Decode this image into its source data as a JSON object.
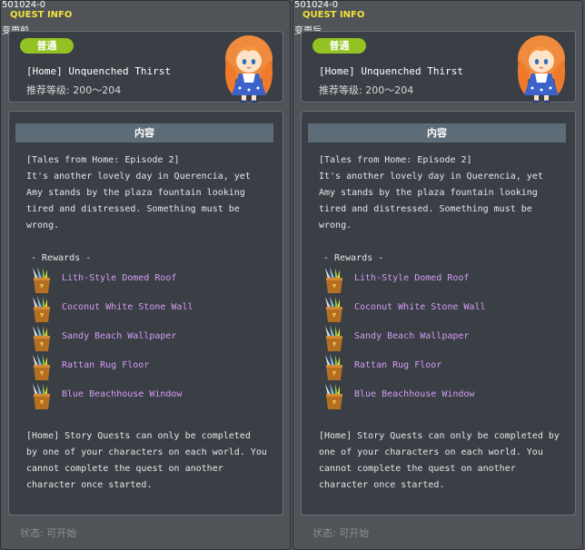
{
  "colors": {
    "title_yellow": "#f4e23a",
    "badge_green": "#93c322",
    "reward_purple": "#d59cf5",
    "panel_bg": "#3a3e45"
  },
  "panels": [
    {
      "quest_id": "501024-0",
      "window_title": "QUEST INFO",
      "state_label": "变更前",
      "badge": "普通",
      "quest_name": "[Home] Unquenched Thirst",
      "recommended_level": "推荐等级: 200～204",
      "content_header": "内容",
      "description_lines": [
        "[Tales from Home: Episode 2]",
        "It's another lovely day in Querencia, yet",
        "Amy stands by the plaza fountain looking",
        "tired and distressed. Something must be",
        "wrong."
      ],
      "rewards_title": "- Rewards -",
      "rewards": [
        "Lith-Style Domed Roof",
        "Coconut White Stone Wall",
        "Sandy Beach Wallpaper",
        "Rattan Rug Floor",
        "Blue Beachhouse Window"
      ],
      "note_lines": [
        "[Home] Story Quests  can only be completed",
        "by one of your characters on each world. You",
        "cannot complete the quest on another",
        "character once started."
      ],
      "status": "状态:  可开始"
    },
    {
      "quest_id": "501024-0",
      "window_title": "QUEST INFO",
      "state_label": "变更后",
      "badge": "普通",
      "quest_name": "[Home] Unquenched Thirst",
      "recommended_level": "推荐等级: 200～204",
      "content_header": "内容",
      "description_lines": [
        "[Tales from Home: Episode 2]",
        "It's another lovely day in Querencia, yet",
        "Amy stands by the plaza fountain looking",
        "tired and distressed. Something must be",
        "wrong."
      ],
      "rewards_title": "- Rewards -",
      "rewards": [
        "Lith-Style Domed Roof",
        "Coconut White Stone Wall",
        "Sandy Beach Wallpaper",
        "Rattan Rug Floor",
        "Blue Beachhouse Window"
      ],
      "note_lines": [
        "[Home] Story Quests can only be completed by",
        "one of your characters on each world. You",
        "cannot complete the quest on another",
        "character once started."
      ],
      "status": "状态:  可开始"
    }
  ]
}
